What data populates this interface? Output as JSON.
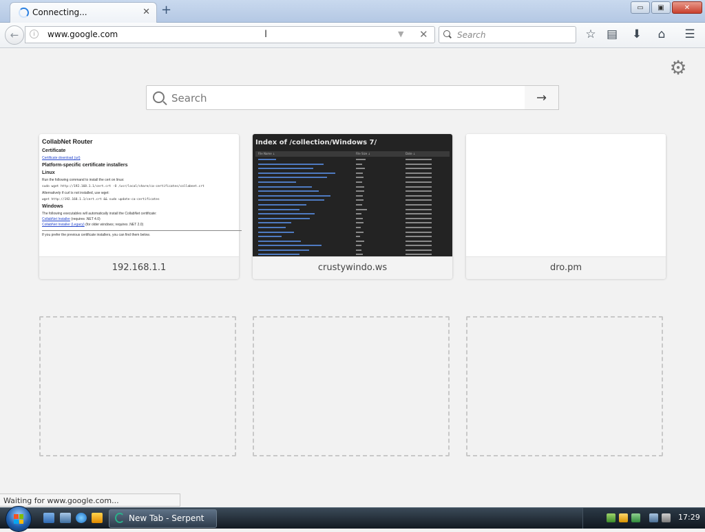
{
  "tab": {
    "title": "Connecting...",
    "close": "✕",
    "new_tab": "+"
  },
  "window_buttons": {
    "minimize": "▭",
    "maximize": "▣",
    "close": "✕"
  },
  "navbar": {
    "back": "←",
    "url": "www.google.com",
    "url_dropdown": "▼",
    "url_stop": "✕",
    "search_placeholder": "Search",
    "icons": [
      "bookmark-star-icon",
      "reading-list-icon",
      "download-icon",
      "home-icon",
      "menu-icon"
    ],
    "glyphs": {
      "bookmark": "☆",
      "list": "▤",
      "download": "⬇",
      "home": "⌂",
      "menu": "☰"
    }
  },
  "newtab": {
    "gear": "⚙",
    "search_placeholder": "Search",
    "go": "→",
    "tiles": [
      {
        "label": "192.168.1.1"
      },
      {
        "label": "crustywindo.ws"
      },
      {
        "label": "dro.pm"
      }
    ]
  },
  "thumb_router": {
    "title": "CollabNet Router",
    "certificate": "Certificate",
    "cert_link": "Certificate download (url)",
    "platform": "Platform-specific certificate installers",
    "linux": "Linux",
    "linux_text": "Run the following command to install the cert on linux:",
    "linux_cmd": "sudo wget http://192.168.1.1/cert.crt -O /usr/local/share/ca-certificates/collabnet.crt",
    "alt_text": "Alternatively if curl is not installed, use wget:",
    "alt_cmd": "wget http://192.168.1.1/cert.crt && sudo update-ca-certificates",
    "windows": "Windows",
    "win_text": "The following executables will automatically install the CollabNet certificate:",
    "win_link1": "CollabNet Installer",
    "win_link1_note": "(requires .NET 4.0)",
    "win_link2": "CollabNet Installer (Legacy)",
    "win_link2_note": "(for older windows; requires .NET 2.0)",
    "footer": "If you prefer the previous certificate installers, you can find them below."
  },
  "thumb_index": {
    "title": "Index of /collection/Windows 7/",
    "col_name": "File Name ↓",
    "col_size": "File Size ↓",
    "col_date": "Date ↓",
    "row_name_widths": [
      26,
      95,
      80,
      112,
      100,
      55,
      78,
      88,
      105,
      96,
      70,
      60,
      82,
      75,
      48,
      40,
      52,
      34,
      62,
      92,
      74,
      60
    ],
    "row_size_widths": [
      14,
      9,
      13,
      10,
      11,
      9,
      12,
      12,
      10,
      11,
      9,
      16,
      8,
      10,
      11,
      7,
      11,
      6,
      12,
      8,
      8,
      10
    ]
  },
  "status": {
    "text": "Waiting for www.google.com..."
  },
  "taskbar": {
    "button_label": "New Tab - Serpent",
    "clock": "17:29"
  },
  "colors": {
    "accent": "#2a7fe0",
    "page_bg": "#f2f2f2",
    "link_blue": "#2244cc",
    "taskbar_dark": "#131a22",
    "serpent_green": "#2ab08a"
  }
}
